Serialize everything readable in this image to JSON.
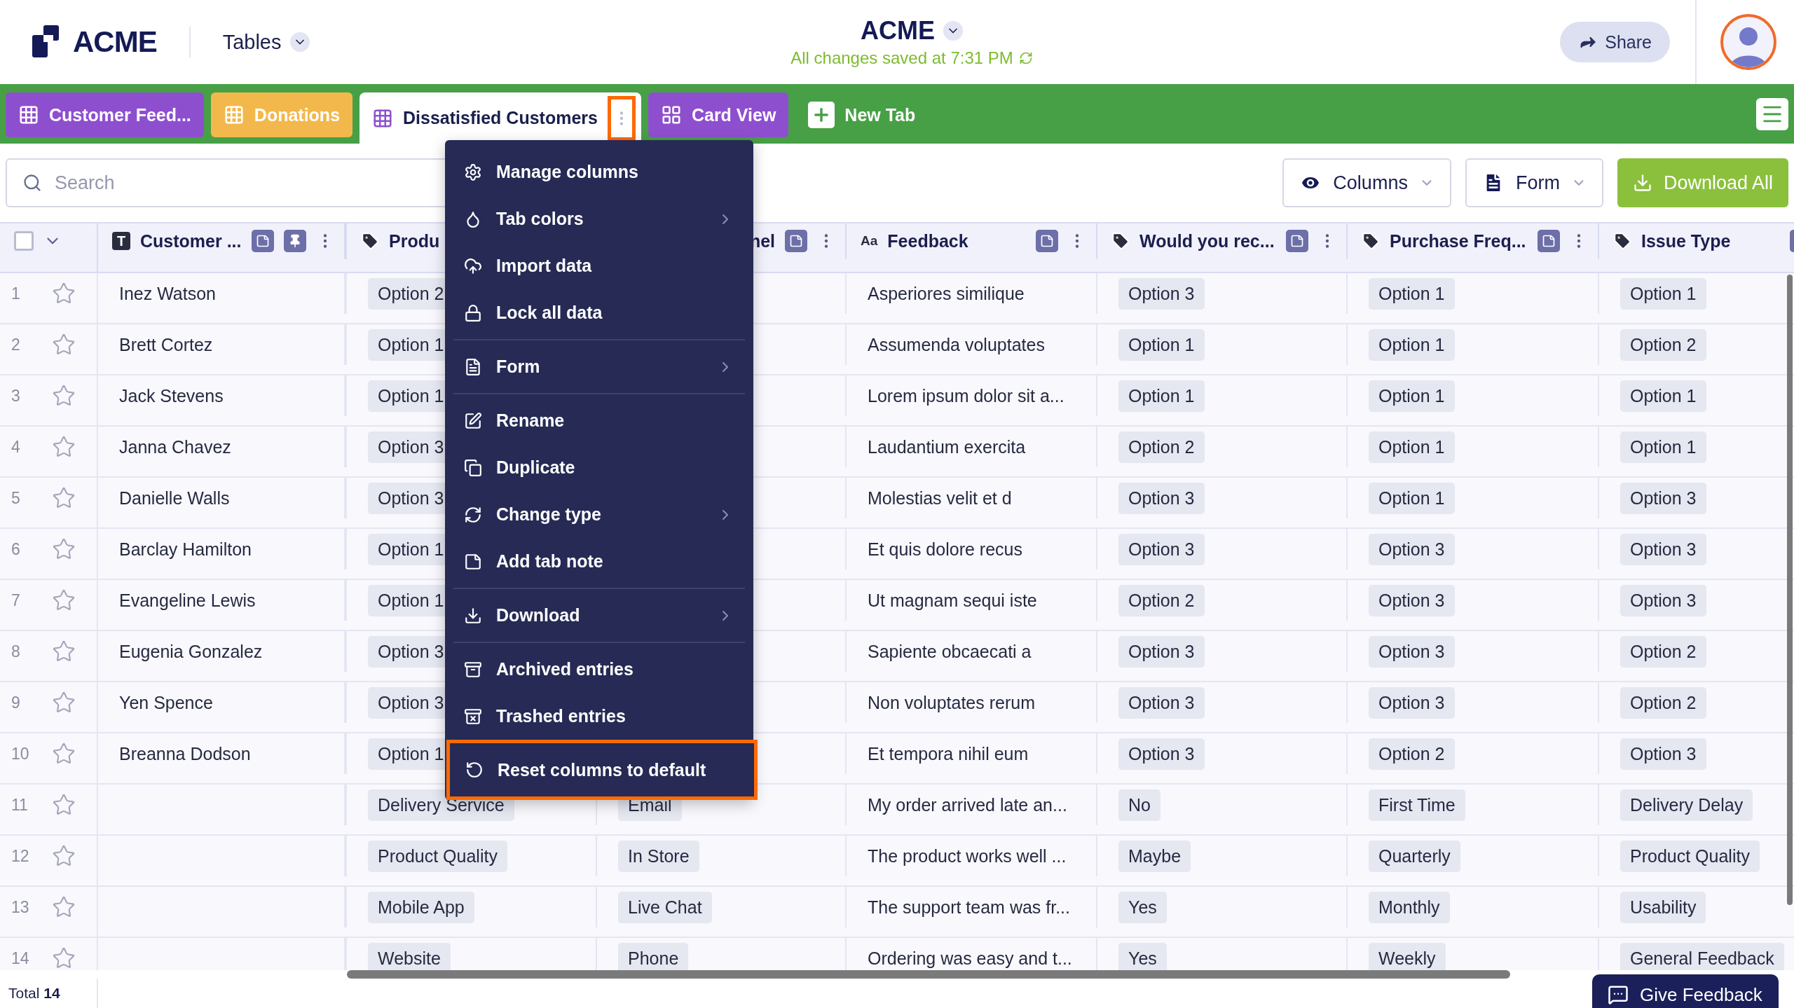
{
  "header": {
    "logo_text": "ACME",
    "nav_label": "Tables",
    "title": "ACME",
    "save_status": "All changes saved at 7:31 PM",
    "share_label": "Share"
  },
  "tabs": [
    {
      "label": "Customer Feed...",
      "kind": "table",
      "color": "#8e4fcf",
      "selected": false
    },
    {
      "label": "Donations",
      "kind": "table",
      "color": "#f2b84b",
      "selected": false
    },
    {
      "label": "Dissatisfied Customers",
      "kind": "table",
      "color": "#8e4fcf",
      "selected": true
    },
    {
      "label": "Card View",
      "kind": "cards",
      "color": "#8e4fcf",
      "selected": false
    },
    {
      "label": "New Tab",
      "kind": "add",
      "selected": false
    }
  ],
  "select_all": {
    "checked": false
  },
  "toolbar": {
    "search_placeholder": "Search",
    "columns_label": "Columns",
    "form_label": "Form",
    "download_label": "Download All"
  },
  "table": {
    "columns": [
      {
        "label": "Customer ...",
        "kind": "text",
        "glyph": "T",
        "note": true,
        "pin": true,
        "more": true,
        "clipped": false
      },
      {
        "label": "Produ",
        "kind": "tag",
        "note": false,
        "pin": false,
        "more": false,
        "clipped": false
      },
      {
        "label": "nel",
        "kind": "tag",
        "note": true,
        "pin": false,
        "more": true,
        "clipped": true
      },
      {
        "label": "Feedback",
        "kind": "text",
        "glyph": "Aa",
        "note": true,
        "pin": false,
        "more": true,
        "clipped": false
      },
      {
        "label": "Would you rec...",
        "kind": "tag",
        "note": true,
        "pin": false,
        "more": true,
        "clipped": false
      },
      {
        "label": "Purchase Freq...",
        "kind": "tag",
        "note": true,
        "pin": false,
        "more": true,
        "clipped": false
      },
      {
        "label": "Issue Type",
        "kind": "tag",
        "note": true,
        "pin": false,
        "more": false,
        "clipped": false
      }
    ],
    "rows": [
      {
        "number": "1",
        "cells": [
          "Inez Watson",
          "Option 2",
          null,
          "Asperiores similique",
          "Option 3",
          "Option 1",
          "Option 1"
        ]
      },
      {
        "number": "2",
        "cells": [
          "Brett Cortez",
          "Option 1",
          null,
          "Assumenda voluptates",
          "Option 1",
          "Option 1",
          "Option 2"
        ]
      },
      {
        "number": "3",
        "cells": [
          "Jack Stevens",
          "Option 1",
          null,
          "Lorem ipsum dolor sit a...",
          "Option 1",
          "Option 1",
          "Option 1"
        ]
      },
      {
        "number": "4",
        "cells": [
          "Janna Chavez",
          "Option 3",
          null,
          "Laudantium exercita",
          "Option 2",
          "Option 1",
          "Option 1"
        ]
      },
      {
        "number": "5",
        "cells": [
          "Danielle Walls",
          "Option 3",
          null,
          "Molestias velit et d",
          "Option 3",
          "Option 1",
          "Option 3"
        ]
      },
      {
        "number": "6",
        "cells": [
          "Barclay Hamilton",
          "Option 1",
          null,
          "Et quis dolore recus",
          "Option 3",
          "Option 3",
          "Option 3"
        ]
      },
      {
        "number": "7",
        "cells": [
          "Evangeline Lewis",
          "Option 1",
          null,
          "Ut magnam sequi iste",
          "Option 2",
          "Option 3",
          "Option 3"
        ]
      },
      {
        "number": "8",
        "cells": [
          "Eugenia Gonzalez",
          "Option 3",
          null,
          "Sapiente obcaecati a",
          "Option 3",
          "Option 3",
          "Option 2"
        ]
      },
      {
        "number": "9",
        "cells": [
          "Yen Spence",
          "Option 3",
          null,
          "Non voluptates rerum",
          "Option 3",
          "Option 3",
          "Option 2"
        ]
      },
      {
        "number": "10",
        "cells": [
          "Breanna Dodson",
          "Option 1",
          null,
          "Et tempora nihil eum",
          "Option 3",
          "Option 2",
          "Option 3"
        ]
      },
      {
        "number": "11",
        "cells": [
          null,
          "Delivery Service",
          "Email",
          "My order arrived late an...",
          "No",
          "First Time",
          "Delivery Delay"
        ]
      },
      {
        "number": "12",
        "cells": [
          null,
          "Product Quality",
          "In Store",
          "The product works well ...",
          "Maybe",
          "Quarterly",
          "Product Quality"
        ]
      },
      {
        "number": "13",
        "cells": [
          null,
          "Mobile App",
          "Live Chat",
          "The support team was fr...",
          "Yes",
          "Monthly",
          "Usability"
        ]
      },
      {
        "number": "14",
        "cells": [
          null,
          "Website",
          "Phone",
          "Ordering was easy and t...",
          "Yes",
          "Weekly",
          "General Feedback"
        ]
      }
    ],
    "total": "Total **14**"
  },
  "context_menu": {
    "groups": [
      [
        {
          "label": "Manage columns",
          "submenu": false,
          "highlighted": false
        },
        {
          "label": "Tab colors",
          "submenu": true,
          "highlighted": false
        },
        {
          "label": "Import data",
          "submenu": false,
          "highlighted": false
        },
        {
          "label": "Lock all data",
          "submenu": false,
          "highlighted": false
        }
      ],
      [
        {
          "label": "Form",
          "submenu": true,
          "highlighted": false
        }
      ],
      [
        {
          "label": "Rename",
          "submenu": false,
          "highlighted": false
        },
        {
          "label": "Duplicate",
          "submenu": false,
          "highlighted": false
        },
        {
          "label": "Change type",
          "submenu": true,
          "highlighted": false
        },
        {
          "label": "Add tab note",
          "submenu": false,
          "highlighted": false
        }
      ],
      [
        {
          "label": "Download",
          "submenu": true,
          "highlighted": false
        }
      ],
      [
        {
          "label": "Archived entries",
          "submenu": false,
          "highlighted": false
        },
        {
          "label": "Trashed entries",
          "submenu": false,
          "highlighted": false
        },
        {
          "label": "Reset columns to default",
          "submenu": false,
          "highlighted": true
        }
      ]
    ]
  },
  "feedback_button": "Give Feedback"
}
